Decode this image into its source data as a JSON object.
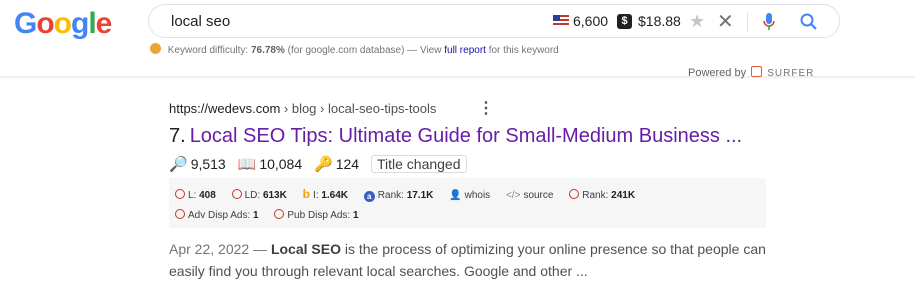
{
  "logo": {
    "g1": "G",
    "o1": "o",
    "o2": "o",
    "g2": "g",
    "l": "l",
    "e": "e"
  },
  "search": {
    "query": "local seo",
    "volume": "6,600",
    "cpc": "$18.88",
    "dollar_badge": "$",
    "star_icon": "star-icon",
    "close_icon": "close-icon",
    "mic_icon": "microphone-icon",
    "search_icon": "search-icon"
  },
  "keyword_difficulty": {
    "label": "Keyword difficulty:",
    "value": "76.78%",
    "db_note": "(for google.com database) — View",
    "report_link": "full report",
    "suffix": "for this keyword"
  },
  "powered": {
    "label": "Powered by",
    "brand": "SURFER"
  },
  "result": {
    "url_host": "https://wedevs.com",
    "url_path": " › blog › local-seo-tips-tools",
    "rank": "7.",
    "title": "Local SEO Tips: Ultimate Guide for Small-Medium Business ...",
    "metrics": {
      "searches": "9,513",
      "pages": "10,084",
      "keywords": "124",
      "tag": "Title changed"
    },
    "seo": {
      "l_label": "L:",
      "l_value": "408",
      "ld_label": "LD:",
      "ld_value": "613K",
      "i_label": "I:",
      "i_value": "1.64K",
      "rank_label": "Rank:",
      "rank_value": "17.1K",
      "whois": "whois",
      "source": "source",
      "rank2_label": "Rank:",
      "rank2_value": "241K",
      "adv_label": "Adv Disp Ads:",
      "adv_value": "1",
      "pub_label": "Pub Disp Ads:",
      "pub_value": "1"
    },
    "snippet": {
      "date": "Apr 22, 2022 —",
      "bold": "Local SEO",
      "text": " is the process of optimizing your online presence so that people can easily find you through relevant local searches. Google and other ..."
    }
  },
  "colors": {
    "visited_link": "#681da8",
    "link": "#1a0dab",
    "google_blue": "#4285f4",
    "google_red": "#ea4335",
    "google_yellow": "#fbbc05",
    "google_green": "#34a853"
  }
}
